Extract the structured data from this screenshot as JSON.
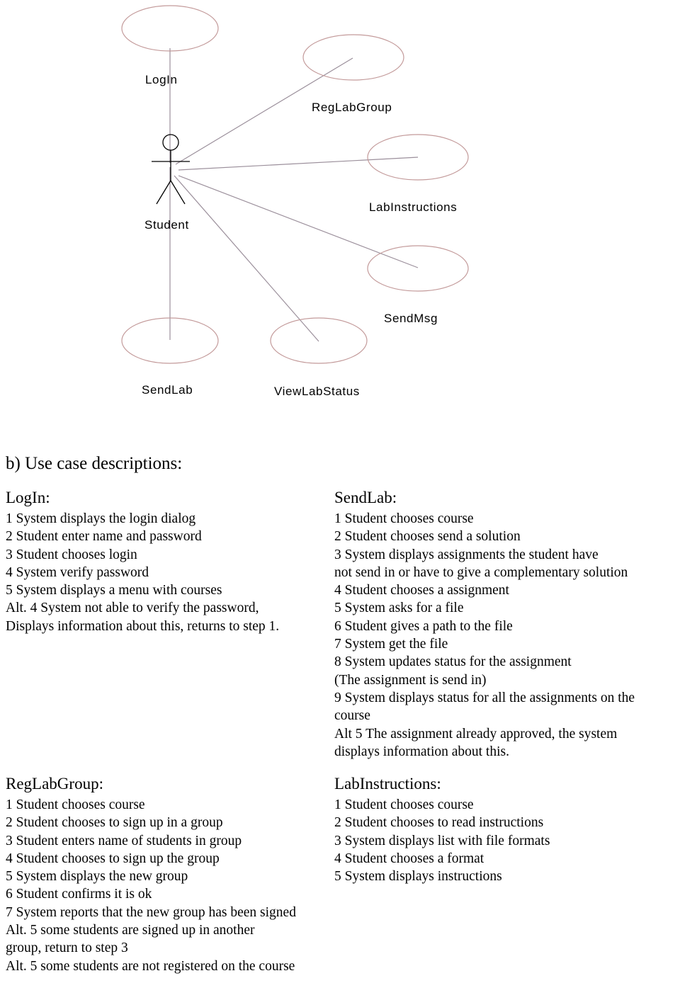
{
  "diagram": {
    "actor_label": "Student",
    "use_cases": [
      {
        "name": "LogIn",
        "label": "LogIn"
      },
      {
        "name": "RegLabGroup",
        "label": "RegLabGroup"
      },
      {
        "name": "LabInstructions",
        "label": "LabInstructions"
      },
      {
        "name": "SendMsg",
        "label": "SendMsg"
      },
      {
        "name": "SendLab",
        "label": "SendLab"
      },
      {
        "name": "ViewLabStatus",
        "label": "ViewLabStatus"
      }
    ],
    "colors": {
      "ellipse_stroke": "#c39a9a",
      "line_stroke": "#9b8f9b",
      "actor_stroke": "#000000"
    }
  },
  "section_heading": "b) Use case descriptions:",
  "usecase_descriptions": [
    {
      "title": "LogIn:",
      "column": "left",
      "steps": [
        "1 System displays the login dialog",
        "2 Student enter name and password",
        "3 Student chooses login",
        "4 System verify password",
        "5 System displays a menu with courses",
        "Alt. 4 System not able to verify the password,",
        "Displays information about this, returns to step 1."
      ]
    },
    {
      "title": "RegLabGroup:",
      "column": "left",
      "steps": [
        "1 Student chooses course",
        "2 Student chooses to sign up in a group",
        "3 Student enters name of students in group",
        "4 Student chooses to sign up the group",
        "5 System displays the new group",
        "6 Student confirms it is ok",
        "7 System reports that the new group has been signed",
        "Alt. 5 some students are signed up in another",
        "group, return to step 3",
        "Alt. 5 some students are not registered on the course"
      ]
    },
    {
      "title": "SendLab:",
      "column": "right",
      "steps": [
        "1 Student chooses course",
        "2 Student chooses send a solution",
        "3 System displays assignments the student have",
        "not send in or have to give a complementary solution",
        "4 Student chooses a assignment",
        "5 System asks for a file",
        "6 Student gives a path to the file",
        "7 System get the file",
        "8 System updates status for the assignment",
        "(The assignment is send in)",
        "9 System displays status for all the assignments on the",
        "course",
        "Alt 5 The assignment already approved, the system",
        "displays information about this."
      ]
    },
    {
      "title": "LabInstructions:",
      "column": "right",
      "steps": [
        "1 Student chooses course",
        "2 Student chooses to read instructions",
        "3 System displays list with file formats",
        "4 Student chooses a format",
        "5 System displays instructions"
      ]
    }
  ]
}
